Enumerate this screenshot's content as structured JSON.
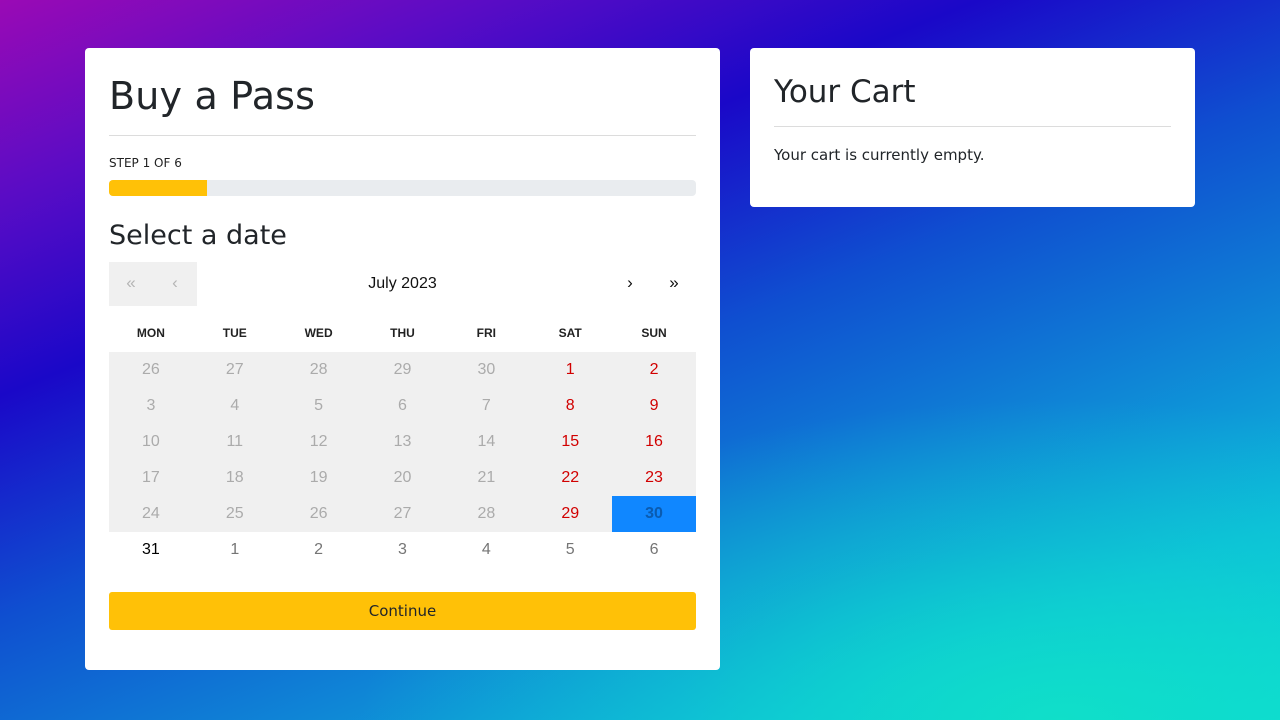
{
  "purchase": {
    "title": "Buy a Pass",
    "step_label": "STEP 1 OF 6",
    "progress_fraction": 0.1667,
    "section_title": "Select a date",
    "continue_label": "Continue",
    "accent_color": "#ffc107"
  },
  "calendar": {
    "month_label": "July 2023",
    "nav": {
      "prev_year": "«",
      "prev_month": "‹",
      "next_month": "›",
      "next_year": "»"
    },
    "weekdays": [
      "MON",
      "TUE",
      "WED",
      "THU",
      "FRI",
      "SAT",
      "SUN"
    ],
    "days": [
      {
        "label": "26",
        "state": "disabled"
      },
      {
        "label": "27",
        "state": "disabled"
      },
      {
        "label": "28",
        "state": "disabled"
      },
      {
        "label": "29",
        "state": "disabled"
      },
      {
        "label": "30",
        "state": "disabled"
      },
      {
        "label": "1",
        "state": "weekend"
      },
      {
        "label": "2",
        "state": "weekend"
      },
      {
        "label": "3",
        "state": "disabled"
      },
      {
        "label": "4",
        "state": "disabled"
      },
      {
        "label": "5",
        "state": "disabled"
      },
      {
        "label": "6",
        "state": "disabled"
      },
      {
        "label": "7",
        "state": "disabled"
      },
      {
        "label": "8",
        "state": "weekend"
      },
      {
        "label": "9",
        "state": "weekend"
      },
      {
        "label": "10",
        "state": "disabled"
      },
      {
        "label": "11",
        "state": "disabled"
      },
      {
        "label": "12",
        "state": "disabled"
      },
      {
        "label": "13",
        "state": "disabled"
      },
      {
        "label": "14",
        "state": "disabled"
      },
      {
        "label": "15",
        "state": "weekend"
      },
      {
        "label": "16",
        "state": "weekend"
      },
      {
        "label": "17",
        "state": "disabled"
      },
      {
        "label": "18",
        "state": "disabled"
      },
      {
        "label": "19",
        "state": "disabled"
      },
      {
        "label": "20",
        "state": "disabled"
      },
      {
        "label": "21",
        "state": "disabled"
      },
      {
        "label": "22",
        "state": "weekend"
      },
      {
        "label": "23",
        "state": "weekend"
      },
      {
        "label": "24",
        "state": "disabled"
      },
      {
        "label": "25",
        "state": "disabled"
      },
      {
        "label": "26",
        "state": "disabled"
      },
      {
        "label": "27",
        "state": "disabled"
      },
      {
        "label": "28",
        "state": "disabled"
      },
      {
        "label": "29",
        "state": "weekend"
      },
      {
        "label": "30",
        "state": "selected"
      },
      {
        "label": "31",
        "state": "active"
      },
      {
        "label": "1",
        "state": "neighbor"
      },
      {
        "label": "2",
        "state": "neighbor"
      },
      {
        "label": "3",
        "state": "neighbor"
      },
      {
        "label": "4",
        "state": "neighbor"
      },
      {
        "label": "5",
        "state": "neighbor"
      },
      {
        "label": "6",
        "state": "neighbor"
      }
    ],
    "selected_color": "#1087ff",
    "weekend_color": "#d10000"
  },
  "cart": {
    "title": "Your Cart",
    "empty_message": "Your cart is currently empty."
  }
}
